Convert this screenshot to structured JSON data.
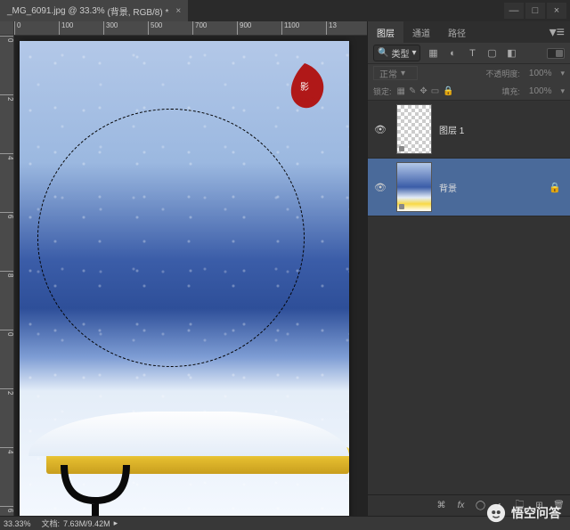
{
  "tab": {
    "filename": "_MG_6091.jpg",
    "zoom": "33.3%",
    "layer_doc_info": "(背景, RGB/8) *"
  },
  "window_controls": {
    "min": "—",
    "max": "□",
    "close": "×"
  },
  "ruler": {
    "h_ticks": [
      "0",
      "100",
      "300",
      "500",
      "700",
      "900",
      "1100",
      "13"
    ],
    "v_ticks": [
      "0",
      "2",
      "4",
      "6",
      "8",
      "0",
      "2",
      "4",
      "6"
    ]
  },
  "status": {
    "zoom": "33.33%",
    "doc_size_label": "文档:",
    "doc_size": "7.63M/9.42M"
  },
  "panel": {
    "tabs": [
      "图层",
      "通道",
      "路径"
    ],
    "filter_label": "类型",
    "toolbar_icons": [
      "image-filter-icon",
      "fx-filter-icon",
      "text-filter-icon",
      "shape-filter-icon",
      "smartobj-filter-icon"
    ],
    "blend_mode": "正常",
    "opacity_label": "不透明度:",
    "opacity_value": "100%",
    "lock_label": "锁定:",
    "fill_label": "填充:",
    "fill_value": "100%",
    "layers": [
      {
        "name": "图层 1",
        "visible": true,
        "locked": false,
        "thumb": "transparent"
      },
      {
        "name": "背景",
        "visible": true,
        "locked": true,
        "thumb": "photo"
      }
    ],
    "bottom_icons": [
      "link-icon",
      "fx-icon",
      "mask-icon",
      "adjustment-icon",
      "group-icon",
      "new-layer-icon",
      "trash-icon"
    ]
  },
  "brand": {
    "text": "悟空问答"
  }
}
